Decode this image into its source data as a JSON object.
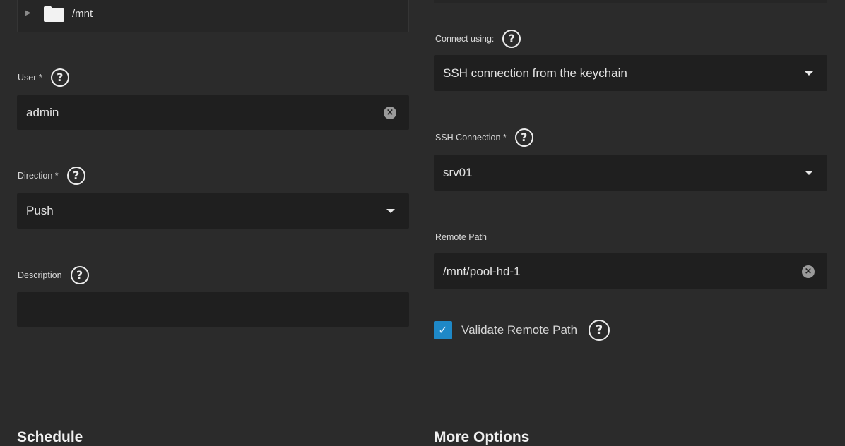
{
  "tree": {
    "path": "/mnt"
  },
  "form": {
    "user": {
      "label": "User *",
      "value": "admin"
    },
    "direction": {
      "label": "Direction *",
      "value": "Push"
    },
    "description": {
      "label": "Description",
      "value": ""
    },
    "connect_using": {
      "label": "Connect using:",
      "value": "SSH connection from the keychain"
    },
    "ssh_connection": {
      "label": "SSH Connection *",
      "value": "srv01"
    },
    "remote_path": {
      "label": "Remote Path",
      "value": "/mnt/pool-hd-1"
    },
    "validate_remote_path": {
      "label": "Validate Remote Path",
      "checked": true
    }
  },
  "sections": {
    "schedule": "Schedule",
    "more_options": "More Options"
  },
  "icons": {
    "help": "?",
    "clear": "×",
    "check": "✓"
  },
  "colors": {
    "background": "#2b2b2b",
    "field": "#1f1f1f",
    "checkbox": "#1e88c7"
  }
}
